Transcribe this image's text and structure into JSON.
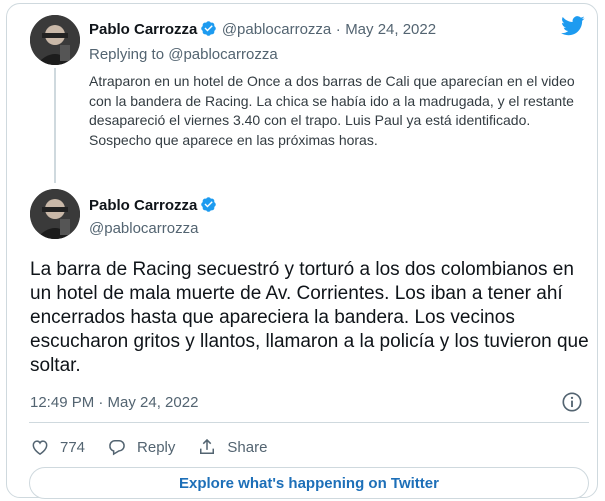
{
  "colors": {
    "brand": "#1d9bf0",
    "link": "#1d6fb8",
    "muted": "#536471",
    "border": "#cfd9de"
  },
  "parent_tweet": {
    "author_name": "Pablo Carrozza",
    "handle": "@pablocarrozza",
    "separator": "·",
    "date": "May 24, 2022",
    "replying_prefix": "Replying to",
    "replying_to": "@pablocarrozza",
    "text": "Atraparon en un hotel de Once a dos barras de Cali que aparecían en el video con la bandera de Racing. La chica se había ido a la madrugada, y el restante desapareció el viernes 3.40 con el trapo. Luis Paul ya está identificado. Sospecho que aparece en las próximas horas.",
    "icons": [
      "verified-badge-icon",
      "twitter-bird-icon"
    ]
  },
  "main_tweet": {
    "author_name": "Pablo Carrozza",
    "handle": "@pablocarrozza",
    "text": "La barra de Racing secuestró y torturó a los dos colombianos en un hotel de mala muerte de Av. Corrientes. Los iban a tener ahí encerrados hasta que apareciera la bandera. Los vecinos escucharon gritos y llantos, llamaron a la policía y los tuvieron que soltar.",
    "timestamp": "12:49 PM · May 24, 2022",
    "icons": [
      "verified-badge-icon",
      "info-icon"
    ]
  },
  "actions": {
    "like_count": "774",
    "reply_label": "Reply",
    "share_label": "Share",
    "icons": [
      "heart-icon",
      "reply-bubble-icon",
      "share-icon"
    ]
  },
  "explore_button": {
    "label": "Explore what's happening on Twitter"
  }
}
